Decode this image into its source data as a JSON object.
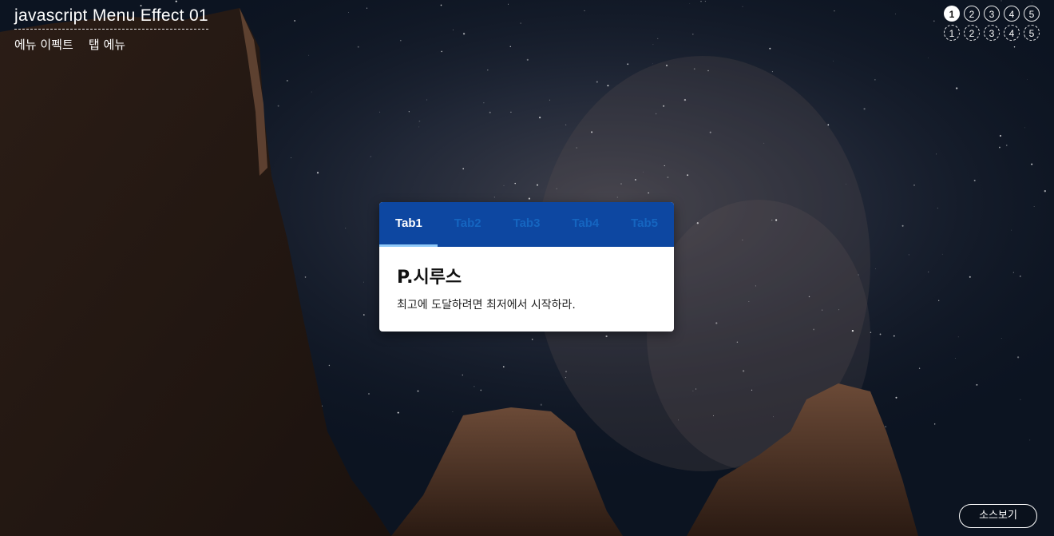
{
  "header": {
    "title": "javascript Menu Effect 01",
    "links": [
      "에뉴 이펙트",
      "탭 에뉴"
    ]
  },
  "pager": {
    "row1": [
      "1",
      "2",
      "3",
      "4",
      "5"
    ],
    "row2": [
      "1",
      "2",
      "3",
      "4",
      "5"
    ],
    "active": "1"
  },
  "tabs": [
    {
      "label": "Tab1",
      "active": true
    },
    {
      "label": "Tab2",
      "active": false
    },
    {
      "label": "Tab3",
      "active": false
    },
    {
      "label": "Tab4",
      "active": false
    },
    {
      "label": "Tab5",
      "active": false
    }
  ],
  "content": {
    "title": "P.시루스",
    "text": "최고에 도달하려면 최저에서 시작하라."
  },
  "source_button": "소스보기",
  "colors": {
    "tab_bar": "#0d47a1",
    "tab_inactive_text": "#1565c0",
    "tab_active_text": "#ffffff"
  }
}
